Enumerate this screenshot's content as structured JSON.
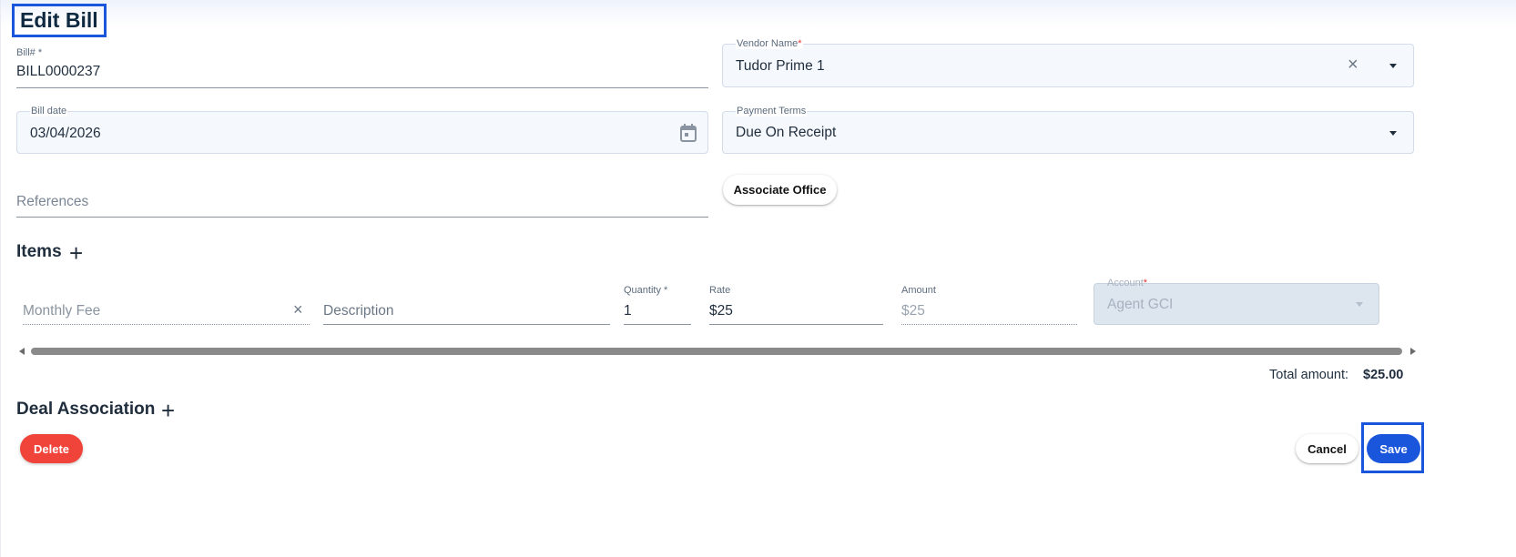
{
  "page": {
    "title": "Edit Bill"
  },
  "form": {
    "bill_number": {
      "label": "Bill# *",
      "value": "BILL0000237"
    },
    "vendor_name": {
      "label": "Vendor Name",
      "required_mark": "*",
      "value": "Tudor Prime 1"
    },
    "bill_date": {
      "label": "Bill date",
      "value": "03/04/2026"
    },
    "payment_terms": {
      "label": "Payment Terms",
      "value": "Due On Receipt"
    },
    "references": {
      "placeholder": "References"
    },
    "associate_office_label": "Associate Office"
  },
  "items": {
    "heading": "Items",
    "add_symbol": "+",
    "row": {
      "item_name": "Monthly Fee",
      "clear_symbol": "×",
      "description_placeholder": "Description",
      "quantity_label": "Quantity *",
      "quantity_value": "1",
      "rate_label": "Rate",
      "rate_value": "$25",
      "amount_label": "Amount",
      "amount_value": "$25",
      "account_label": "Account",
      "account_required_mark": "*",
      "account_value": "Agent GCI"
    }
  },
  "totals": {
    "label": "Total amount:",
    "value": "$25.00"
  },
  "deal_association": {
    "heading": "Deal Association",
    "add_symbol": "+"
  },
  "actions": {
    "delete_label": "Delete",
    "cancel_label": "Cancel",
    "save_label": "Save"
  },
  "icons": {
    "clear": "close-icon",
    "dropdown": "caret-down-icon",
    "calendar": "calendar-icon",
    "add": "plus-icon"
  },
  "colors": {
    "primary": "#1a56db",
    "danger": "#f0433a",
    "heading": "#0f2940"
  }
}
